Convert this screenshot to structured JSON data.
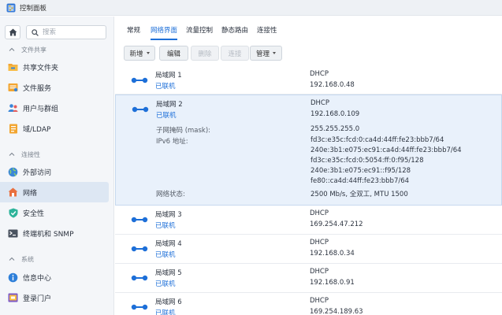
{
  "window": {
    "title": "控制面板"
  },
  "sidebar": {
    "search_placeholder": "搜索",
    "sections": [
      {
        "label": "文件共享",
        "items": [
          {
            "label": "共享文件夹",
            "icon": "folder-icon"
          },
          {
            "label": "文件服务",
            "icon": "file-services-icon"
          },
          {
            "label": "用户与群组",
            "icon": "users-icon"
          },
          {
            "label": "域/LDAP",
            "icon": "domain-icon"
          }
        ]
      },
      {
        "label": "连接性",
        "items": [
          {
            "label": "外部访问",
            "icon": "globe-icon"
          },
          {
            "label": "网络",
            "icon": "house-network-icon",
            "active": true
          },
          {
            "label": "安全性",
            "icon": "shield-icon"
          },
          {
            "label": "终端机和 SNMP",
            "icon": "terminal-icon"
          }
        ]
      },
      {
        "label": "系统",
        "items": [
          {
            "label": "信息中心",
            "icon": "info-icon"
          },
          {
            "label": "登录门户",
            "icon": "portal-icon"
          }
        ]
      }
    ]
  },
  "tabs": [
    {
      "label": "常规"
    },
    {
      "label": "网络界面",
      "active": true
    },
    {
      "label": "流量控制"
    },
    {
      "label": "静态路由"
    },
    {
      "label": "连接性"
    }
  ],
  "toolbar": {
    "create": "新增",
    "edit": "编辑",
    "delete": "删除",
    "connect": "连接",
    "manage": "管理"
  },
  "interfaces": [
    {
      "name": "局域网 1",
      "status": "已联机",
      "mode": "DHCP",
      "ip": "192.168.0.48"
    },
    {
      "name": "局域网 2",
      "status": "已联机",
      "mode": "DHCP",
      "ip": "192.168.0.109",
      "selected": true,
      "details": {
        "mask_label": "子网掩码 (mask):",
        "mask": "255.255.255.0",
        "ipv6_label": "IPv6 地址:",
        "ipv6": [
          "fd3c:e35c:fcd:0:ca4d:44ff:fe23:bbb7/64",
          "240e:3b1:e075:ec91:ca4d:44ff:fe23:bbb7/64",
          "fd3c:e35c:fcd:0:5054:ff:0:f95/128",
          "240e:3b1:e075:ec91::f95/128",
          "fe80::ca4d:44ff:fe23:bbb7/64"
        ],
        "net_status_label": "网络状态:",
        "net_status": "2500 Mb/s, 全双工, MTU 1500"
      }
    },
    {
      "name": "局域网 3",
      "status": "已联机",
      "mode": "DHCP",
      "ip": "169.254.47.212"
    },
    {
      "name": "局域网 4",
      "status": "已联机",
      "mode": "DHCP",
      "ip": "192.168.0.34"
    },
    {
      "name": "局域网 5",
      "status": "已联机",
      "mode": "DHCP",
      "ip": "192.168.0.91"
    },
    {
      "name": "局域网 6",
      "status": "已联机",
      "mode": "DHCP",
      "ip": "169.254.189.63"
    }
  ],
  "colors": {
    "accent": "#1d6fd8",
    "selected_bg": "#e9f1fb",
    "sidebar_bg": "#f4f6f9"
  }
}
